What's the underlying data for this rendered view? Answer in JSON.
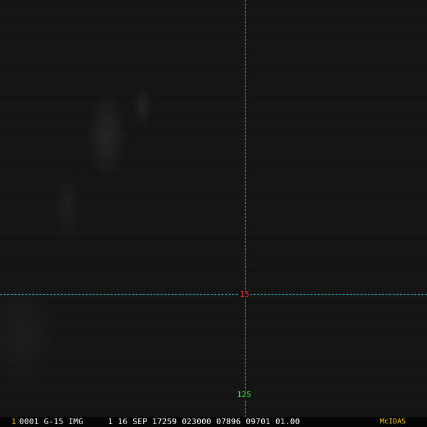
{
  "gridlines": {
    "latitude_label": "15",
    "longitude_label": "125",
    "latitude_color": "#ff3030",
    "longitude_color": "#33ff33",
    "line_color": "#2fd6d6"
  },
  "statusbar": {
    "frame_number": "1",
    "frame_color": "#ffd700",
    "info": "0001 G-15 IMG     1 16 SEP 17259 023000 07896 09701 01.00",
    "info_color": "#ffffff",
    "brand": "McIDAS",
    "brand_color": "#ffd700"
  },
  "imagery": {
    "background_color": "#161616"
  }
}
